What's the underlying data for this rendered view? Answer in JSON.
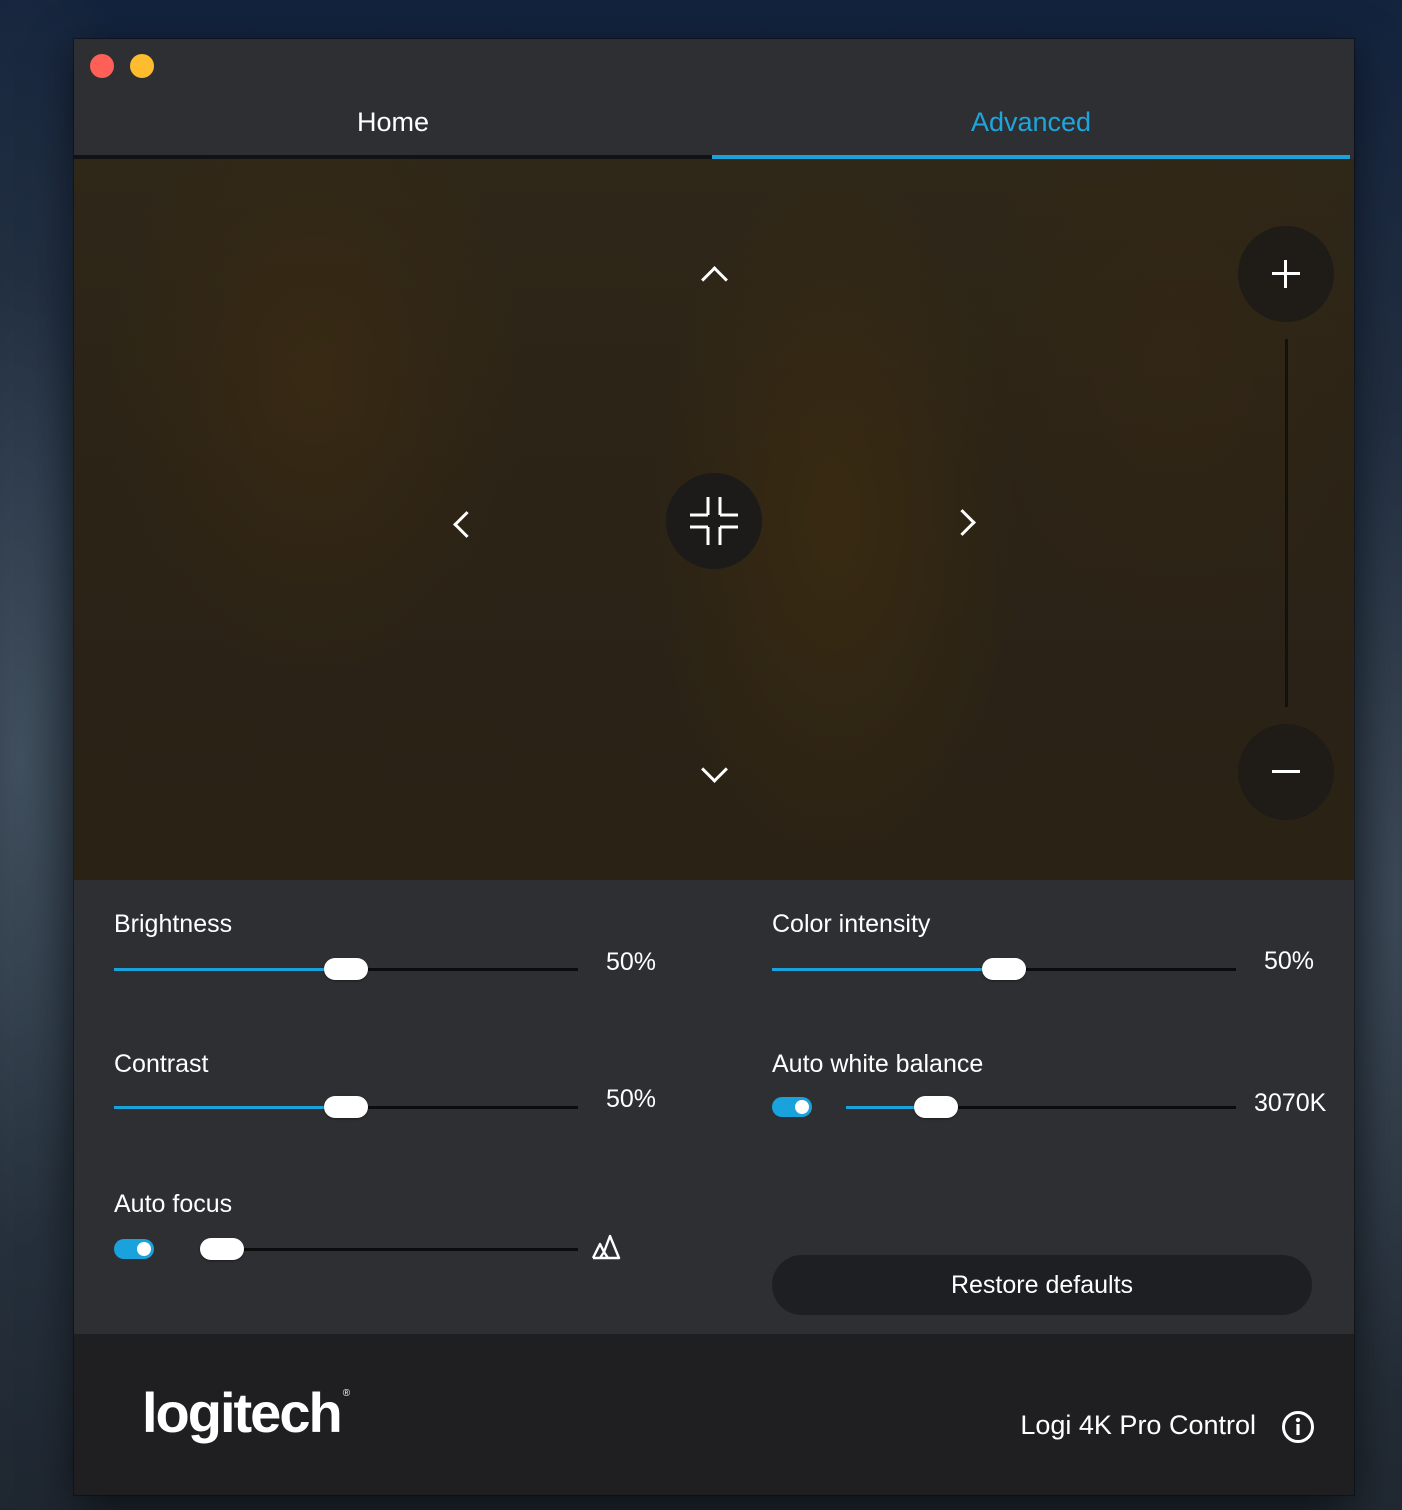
{
  "window": {
    "traffic_lights": {
      "close_color": "#fe5f57",
      "minimize_color": "#febc2e"
    }
  },
  "tabs": [
    {
      "label": "Home",
      "active": false
    },
    {
      "label": "Advanced",
      "active": true
    }
  ],
  "preview": {
    "pan_controls": [
      "chevron-up-icon",
      "chevron-down-icon",
      "chevron-left-icon",
      "chevron-right-icon"
    ],
    "center_icon": "center-crosshair-icon",
    "zoom": {
      "plus_icon": "plus-icon",
      "minus_icon": "minus-icon",
      "level": 0.0
    }
  },
  "settings": {
    "brightness": {
      "label": "Brightness",
      "value": "50%",
      "fraction": 0.5
    },
    "contrast": {
      "label": "Contrast",
      "value": "50%",
      "fraction": 0.5
    },
    "auto_focus": {
      "label": "Auto focus",
      "enabled": true,
      "fraction": 0.0,
      "icon": "mountain-focus-icon"
    },
    "color_intensity": {
      "label": "Color intensity",
      "value": "50%",
      "fraction": 0.5
    },
    "auto_white_balance": {
      "label": "Auto white balance",
      "value": "3070K",
      "enabled": true,
      "fraction": 0.23
    },
    "restore_label": "Restore defaults"
  },
  "footer": {
    "logo_text": "logitech",
    "logo_mark": "®",
    "product_name": "Logi 4K Pro Control",
    "info_icon": "info-icon"
  },
  "colors": {
    "accent": "#1aa2dc",
    "window_bg": "#2e2f33",
    "footer_bg": "#1f1f21"
  }
}
